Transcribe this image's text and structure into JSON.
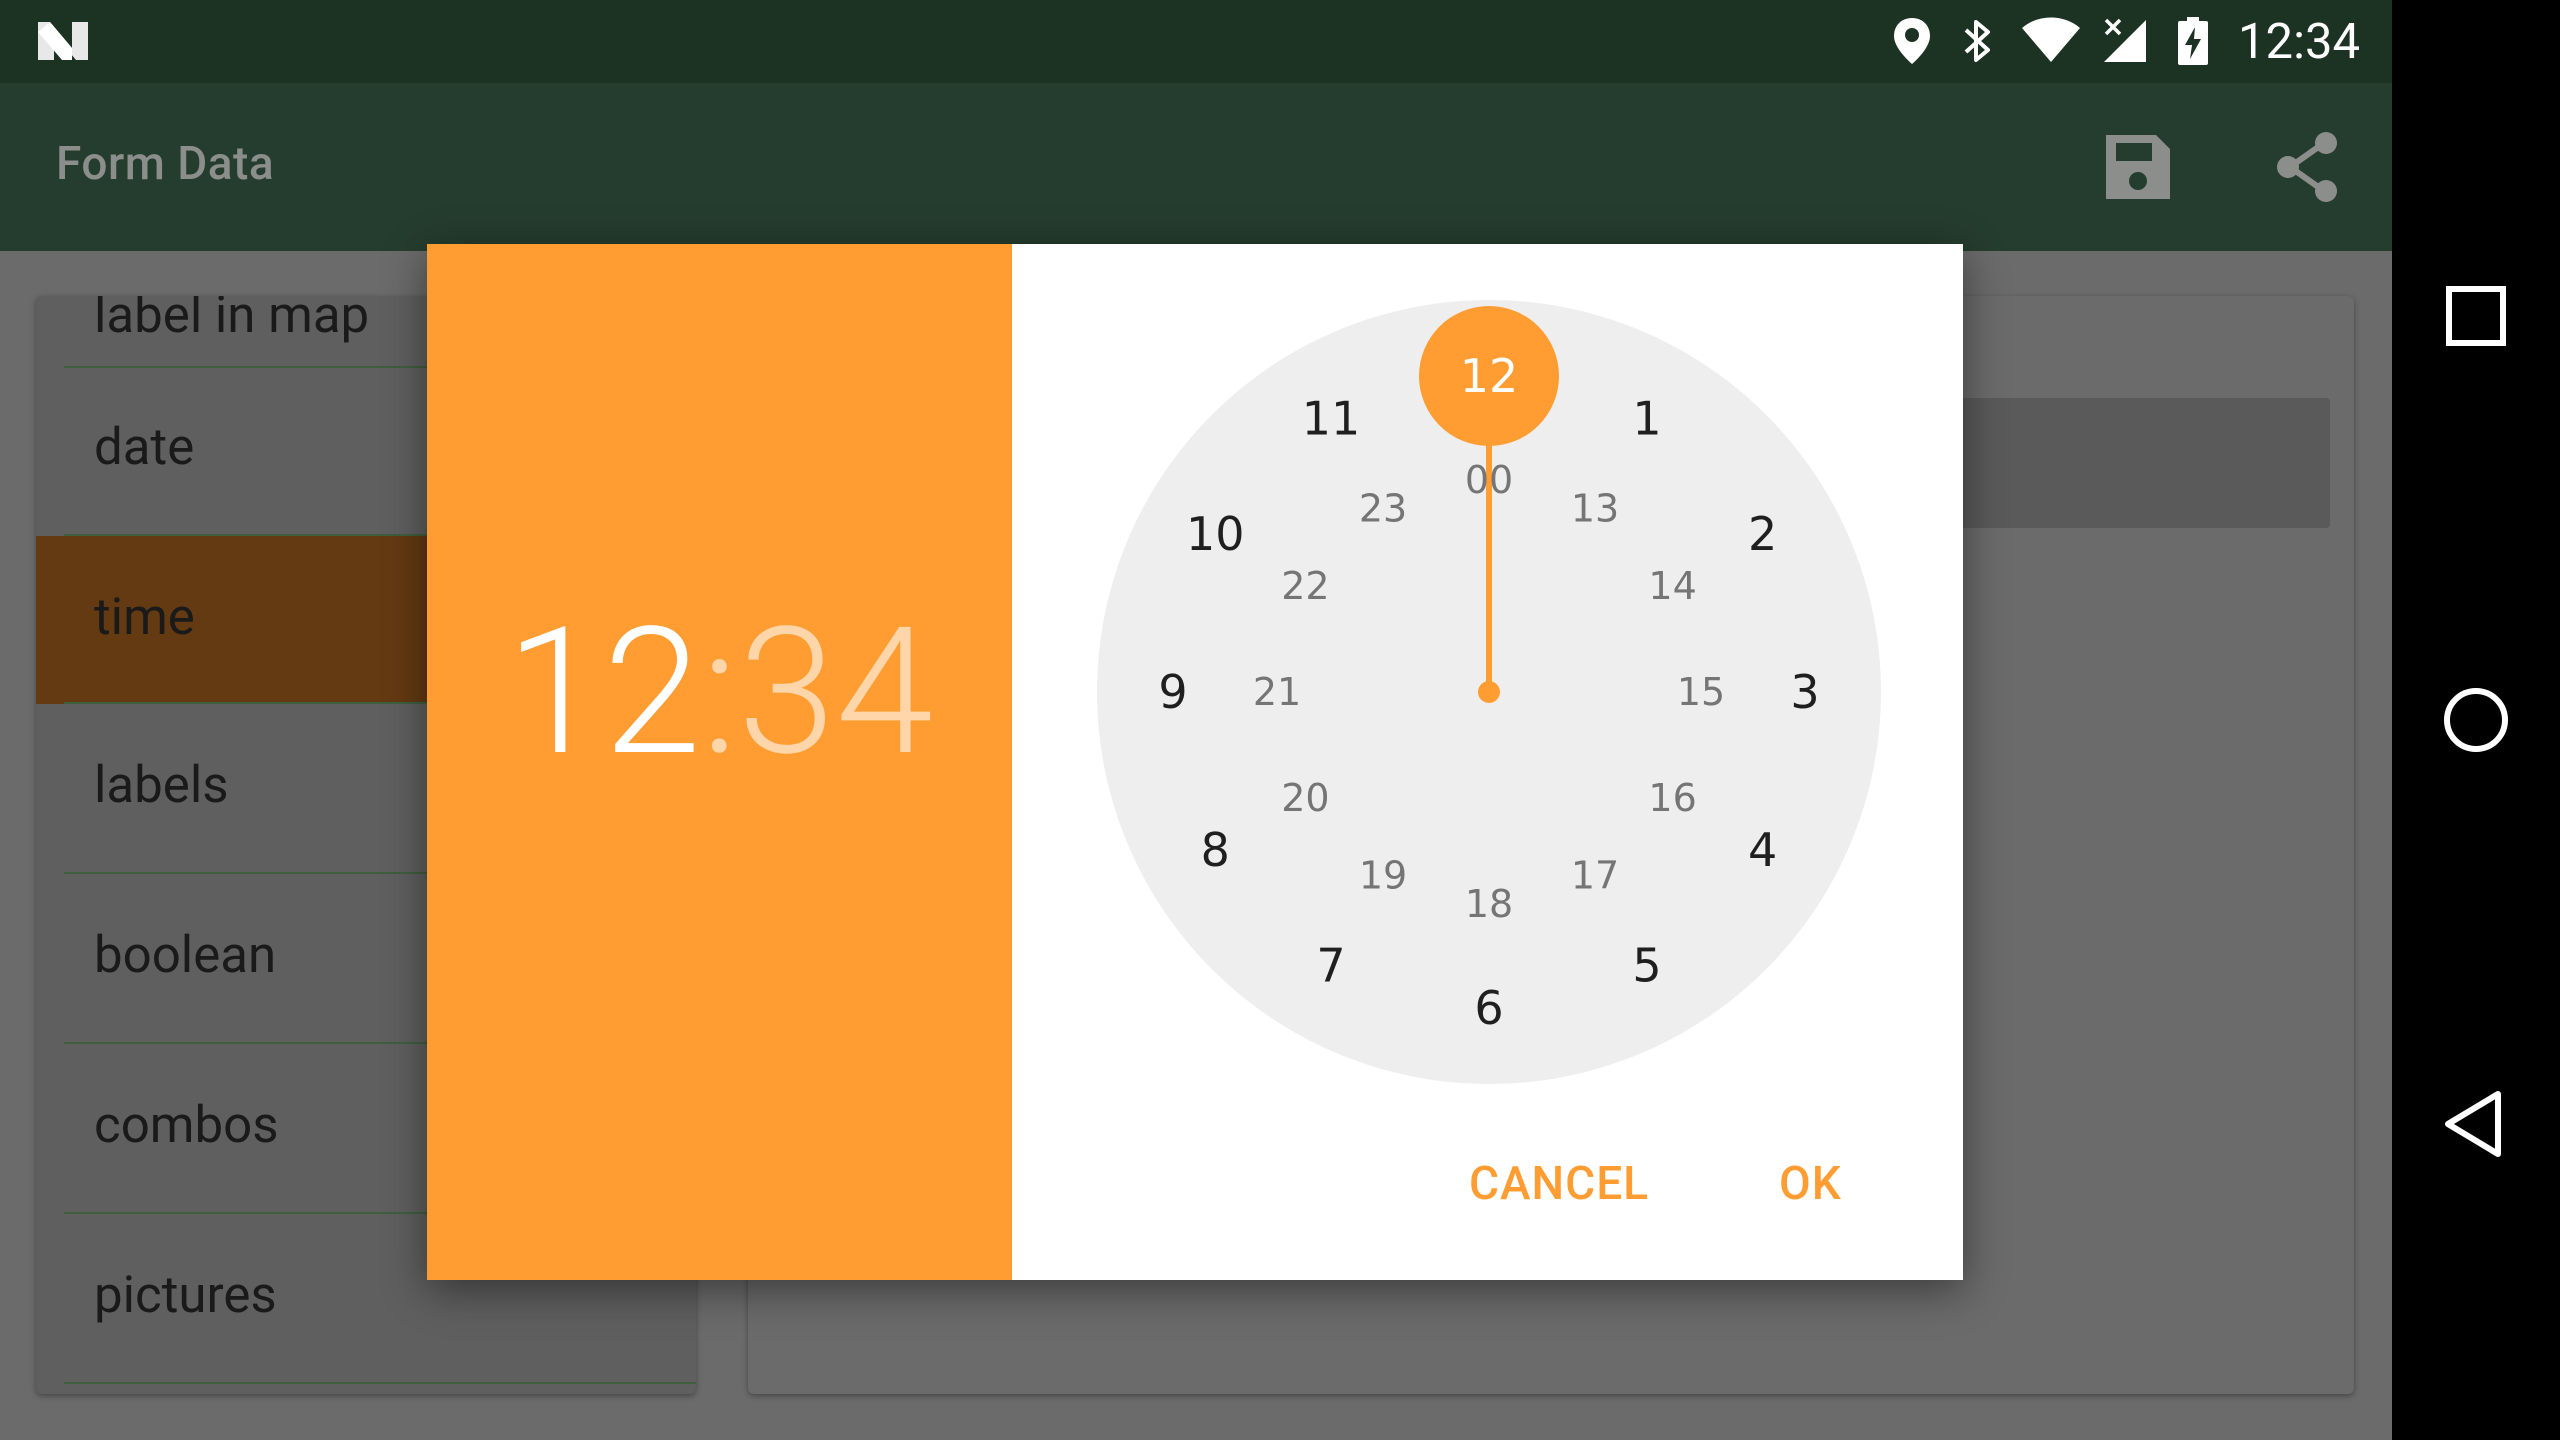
{
  "status_bar": {
    "logo": "n-logo-icon",
    "icons": [
      "location-icon",
      "bluetooth-icon",
      "wifi-icon",
      "cellular-no-signal-icon",
      "battery-charging-icon"
    ],
    "time": "12:34"
  },
  "app_bar": {
    "title": "Form Data",
    "actions": [
      "save-icon",
      "share-icon"
    ]
  },
  "nav_bar": {
    "buttons": [
      "recents-icon",
      "home-icon",
      "back-icon"
    ]
  },
  "list": {
    "partial_label": "label in map",
    "items": [
      {
        "label": "date",
        "selected": false
      },
      {
        "label": "time",
        "selected": true
      },
      {
        "label": "labels",
        "selected": false
      },
      {
        "label": "boolean",
        "selected": false
      },
      {
        "label": "combos",
        "selected": false
      },
      {
        "label": "pictures",
        "selected": false
      }
    ]
  },
  "dialog": {
    "hour": "12",
    "separator": ":",
    "minute": "34",
    "selected_hour": "12",
    "outer_numbers": [
      "12",
      "1",
      "2",
      "3",
      "4",
      "5",
      "6",
      "7",
      "8",
      "9",
      "10",
      "11"
    ],
    "inner_numbers": [
      "00",
      "13",
      "14",
      "15",
      "16",
      "17",
      "18",
      "19",
      "20",
      "21",
      "22",
      "23"
    ],
    "cancel_label": "CANCEL",
    "ok_label": "OK",
    "accent_color": "#ff9d33"
  }
}
